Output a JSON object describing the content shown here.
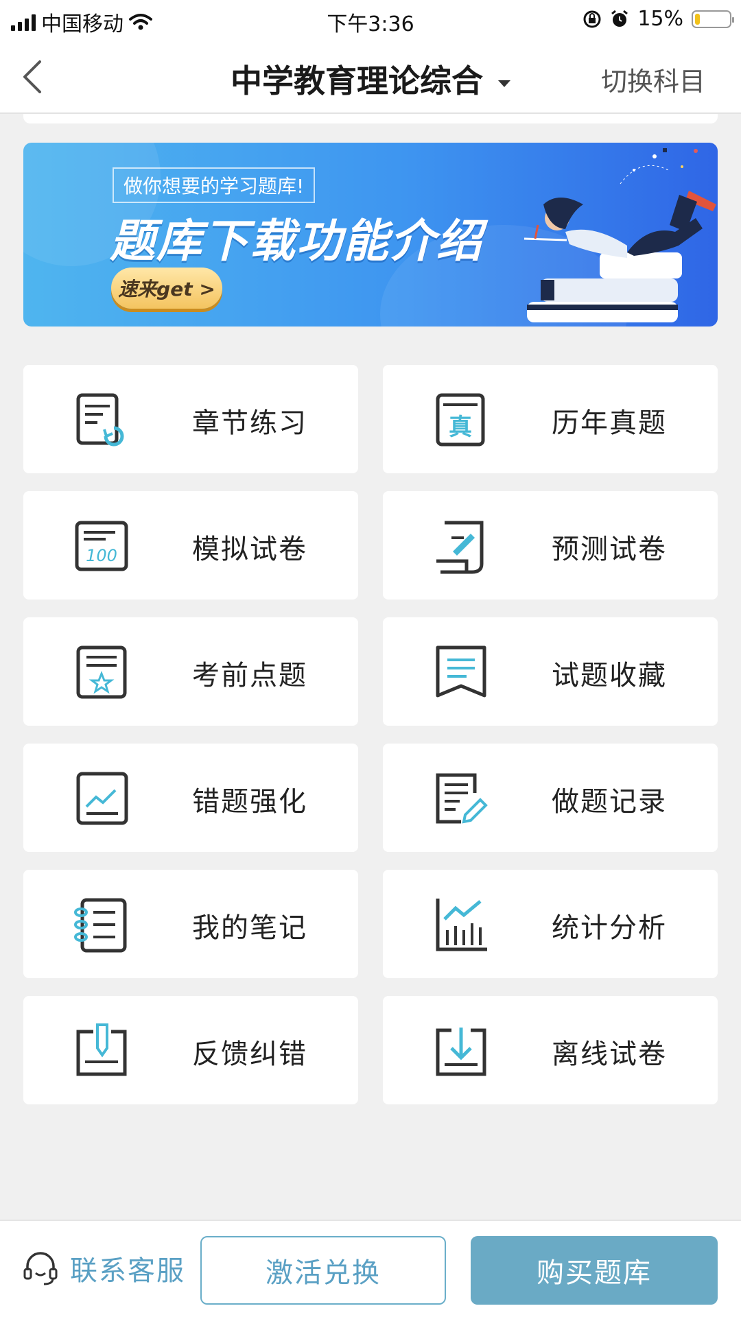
{
  "status_bar": {
    "carrier": "中国移动",
    "time": "下午3:36",
    "battery": "15%",
    "battery_level": 0.15
  },
  "nav": {
    "title": "中学教育理论综合",
    "switch_label": "切换科目"
  },
  "banner": {
    "tagline": "做你想要的学习题库!",
    "headline": "题库下载功能介绍",
    "cta": "速来get >"
  },
  "features": [
    {
      "label": "章节练习",
      "icon": "chapter-practice-icon"
    },
    {
      "label": "历年真题",
      "icon": "past-exam-icon"
    },
    {
      "label": "模拟试卷",
      "icon": "mock-paper-icon"
    },
    {
      "label": "预测试卷",
      "icon": "prediction-paper-icon"
    },
    {
      "label": "考前点题",
      "icon": "pre-exam-tips-icon"
    },
    {
      "label": "试题收藏",
      "icon": "bookmark-icon"
    },
    {
      "label": "错题强化",
      "icon": "mistake-review-icon"
    },
    {
      "label": "做题记录",
      "icon": "practice-record-icon"
    },
    {
      "label": "我的笔记",
      "icon": "notebook-icon"
    },
    {
      "label": "统计分析",
      "icon": "statistics-icon"
    },
    {
      "label": "反馈纠错",
      "icon": "feedback-icon"
    },
    {
      "label": "离线试卷",
      "icon": "offline-download-icon"
    }
  ],
  "bottom_bar": {
    "service_label": "联系客服",
    "activate_label": "激活兑换",
    "buy_label": "购买题库"
  },
  "colors": {
    "accent": "#45b8d6",
    "icon_stroke": "#333333",
    "primary_button": "#6aaac5"
  }
}
